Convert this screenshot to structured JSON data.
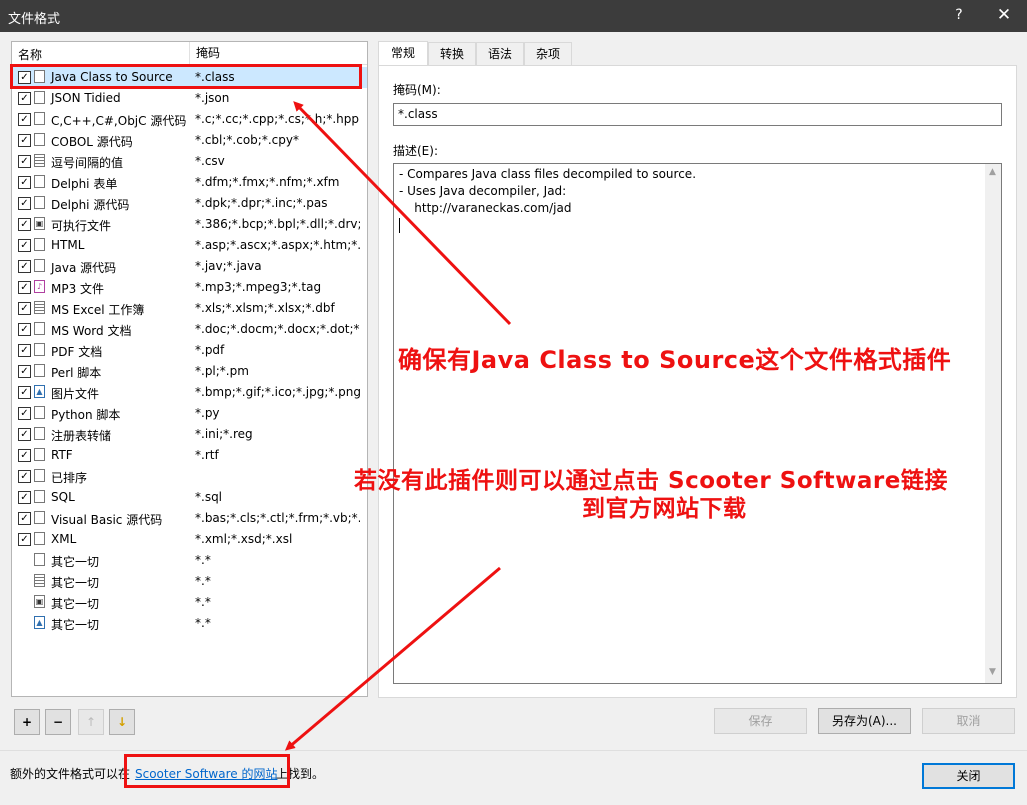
{
  "window": {
    "title": "文件格式",
    "help": "?",
    "close": "✕"
  },
  "list": {
    "headers": {
      "name": "名称",
      "mask": "掩码"
    },
    "rows": [
      {
        "name": "Java Class to Source",
        "mask": "*.class",
        "checked": true,
        "icon": "document-icon"
      },
      {
        "name": "JSON Tidied",
        "mask": "*.json",
        "checked": true,
        "icon": "document-icon"
      },
      {
        "name": "C,C++,C#,ObjC 源代码",
        "mask": "*.c;*.cc;*.cpp;*.cs;*.h;*.hpp;*...",
        "checked": true,
        "icon": "document-icon"
      },
      {
        "name": "COBOL 源代码",
        "mask": "*.cbl;*.cob;*.cpy*",
        "checked": true,
        "icon": "document-icon"
      },
      {
        "name": "逗号间隔的值",
        "mask": "*.csv",
        "checked": true,
        "icon": "table-icon"
      },
      {
        "name": "Delphi 表单",
        "mask": "*.dfm;*.fmx;*.nfm;*.xfm",
        "checked": true,
        "icon": "document-icon"
      },
      {
        "name": "Delphi 源代码",
        "mask": "*.dpk;*.dpr;*.inc;*.pas",
        "checked": true,
        "icon": "document-icon"
      },
      {
        "name": "可执行文件",
        "mask": "*.386;*.bcp;*.bpl;*.dll;*.drv;...",
        "checked": true,
        "icon": "executable-icon"
      },
      {
        "name": "HTML",
        "mask": "*.asp;*.ascx;*.aspx;*.htm;*...",
        "checked": true,
        "icon": "document-icon"
      },
      {
        "name": "Java 源代码",
        "mask": "*.jav;*.java",
        "checked": true,
        "icon": "document-icon"
      },
      {
        "name": "MP3 文件",
        "mask": "*.mp3;*.mpeg3;*.tag",
        "checked": true,
        "icon": "music-icon"
      },
      {
        "name": "MS Excel 工作簿",
        "mask": "*.xls;*.xlsm;*.xlsx;*.dbf",
        "checked": true,
        "icon": "table-icon"
      },
      {
        "name": "MS Word 文档",
        "mask": "*.doc;*.docm;*.docx;*.dot;*...",
        "checked": true,
        "icon": "document-icon"
      },
      {
        "name": "PDF 文档",
        "mask": "*.pdf",
        "checked": true,
        "icon": "document-icon"
      },
      {
        "name": "Perl 脚本",
        "mask": "*.pl;*.pm",
        "checked": true,
        "icon": "document-icon"
      },
      {
        "name": "图片文件",
        "mask": "*.bmp;*.gif;*.ico;*.jpg;*.png...",
        "checked": true,
        "icon": "picture-icon"
      },
      {
        "name": "Python 脚本",
        "mask": "*.py",
        "checked": true,
        "icon": "document-icon"
      },
      {
        "name": "注册表转储",
        "mask": "*.ini;*.reg",
        "checked": true,
        "icon": "document-icon"
      },
      {
        "name": "RTF",
        "mask": "*.rtf",
        "checked": true,
        "icon": "document-icon"
      },
      {
        "name": "已排序",
        "mask": "",
        "checked": true,
        "icon": "document-icon"
      },
      {
        "name": "SQL",
        "mask": "*.sql",
        "checked": true,
        "icon": "document-icon"
      },
      {
        "name": "Visual Basic 源代码",
        "mask": "*.bas;*.cls;*.ctl;*.frm;*.vb;*.v...",
        "checked": true,
        "icon": "document-icon"
      },
      {
        "name": "XML",
        "mask": "*.xml;*.xsd;*.xsl",
        "checked": true,
        "icon": "document-icon"
      },
      {
        "name": "其它一切",
        "mask": "*.*",
        "checked": false,
        "icon": "document-icon"
      },
      {
        "name": "其它一切",
        "mask": "*.*",
        "checked": false,
        "icon": "table-icon"
      },
      {
        "name": "其它一切",
        "mask": "*.*",
        "checked": false,
        "icon": "executable-icon"
      },
      {
        "name": "其它一切",
        "mask": "*.*",
        "checked": false,
        "icon": "picture-icon"
      }
    ],
    "selected_index": 0
  },
  "list_buttons": {
    "add": "+",
    "remove": "−",
    "up": "↑",
    "down": "↓"
  },
  "tabs": [
    {
      "label": "常规",
      "active": true
    },
    {
      "label": "转换",
      "active": false
    },
    {
      "label": "语法",
      "active": false
    },
    {
      "label": "杂项",
      "active": false
    }
  ],
  "general": {
    "mask_label": "掩码(M):",
    "mask_value": "*.class",
    "desc_label": "描述(E):",
    "desc_lines": [
      "- Compares Java class files decompiled to source.",
      "- Uses Java decompiler, Jad:",
      "    http://varaneckas.com/jad"
    ]
  },
  "action_buttons": {
    "save": "保存",
    "save_as": "另存为(A)...",
    "cancel": "取消"
  },
  "footer": {
    "text_before": "额外的文件格式可以在",
    "link": "Scooter Software 的网站",
    "text_after": "上找到。",
    "close": "关闭"
  },
  "annotations": {
    "note1": "确保有Java Class to Source这个文件格式插件",
    "note2_line1": "若没有此插件则可以通过点击 Scooter Software链接",
    "note2_line2": "到官方网站下载"
  },
  "colors": {
    "annotation": "#e11111",
    "selection": "#cce8ff",
    "link": "#0066cc"
  }
}
